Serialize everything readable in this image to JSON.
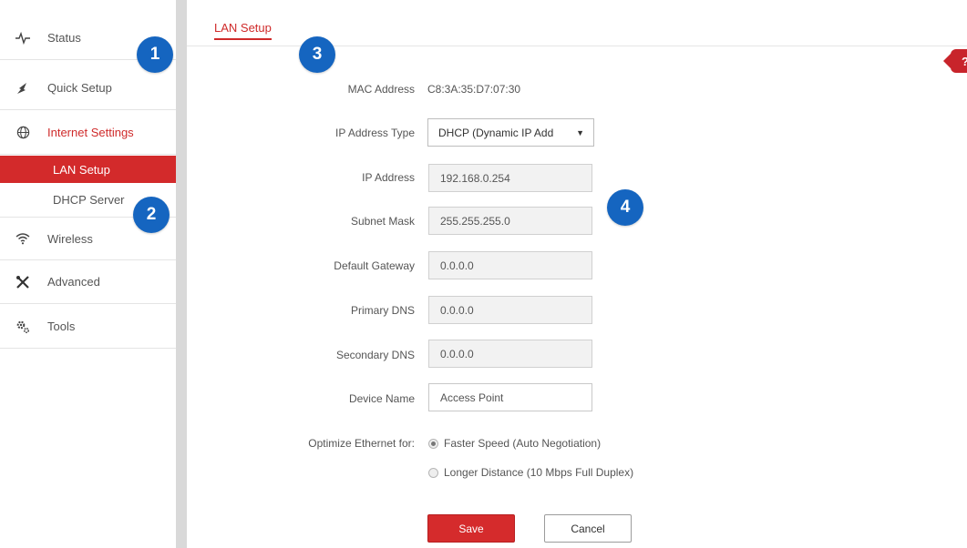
{
  "sidebar": {
    "items": [
      {
        "label": "Status",
        "icon": "activity-icon"
      },
      {
        "label": "Quick Setup",
        "icon": "rocket-icon"
      },
      {
        "label": "Internet Settings",
        "icon": "globe-icon",
        "active": true
      },
      {
        "label": "Wireless",
        "icon": "wifi-icon"
      },
      {
        "label": "Advanced",
        "icon": "tools-crossed-icon"
      },
      {
        "label": "Tools",
        "icon": "gears-icon"
      }
    ],
    "subitems": [
      {
        "label": "LAN Setup",
        "selected": true
      },
      {
        "label": "DHCP Server",
        "selected": false
      }
    ]
  },
  "tab": {
    "label": "LAN Setup"
  },
  "help": {
    "label": "?"
  },
  "form": {
    "mac_label": "MAC Address",
    "mac_value": "C8:3A:35:D7:07:30",
    "ip_type_label": "IP Address Type",
    "ip_type_value": "DHCP (Dynamic IP Add",
    "ip_label": "IP Address",
    "ip_value": "192.168.0.254",
    "subnet_label": "Subnet Mask",
    "subnet_value": "255.255.255.0",
    "gateway_label": "Default Gateway",
    "gateway_value": "0.0.0.0",
    "dns1_label": "Primary DNS",
    "dns1_value": "0.0.0.0",
    "dns2_label": "Secondary DNS",
    "dns2_value": "0.0.0.0",
    "device_label": "Device Name",
    "device_value": "Access Point",
    "optimize_label": "Optimize Ethernet for:",
    "options": [
      {
        "label": "Faster Speed (Auto Negotiation)",
        "checked": true
      },
      {
        "label": "Longer Distance (10 Mbps Full Duplex)",
        "checked": false
      }
    ]
  },
  "buttons": {
    "save": "Save",
    "cancel": "Cancel"
  },
  "badges": [
    "1",
    "2",
    "3",
    "4"
  ],
  "colors": {
    "accent": "#d32a2b",
    "badge": "#1565c0"
  }
}
